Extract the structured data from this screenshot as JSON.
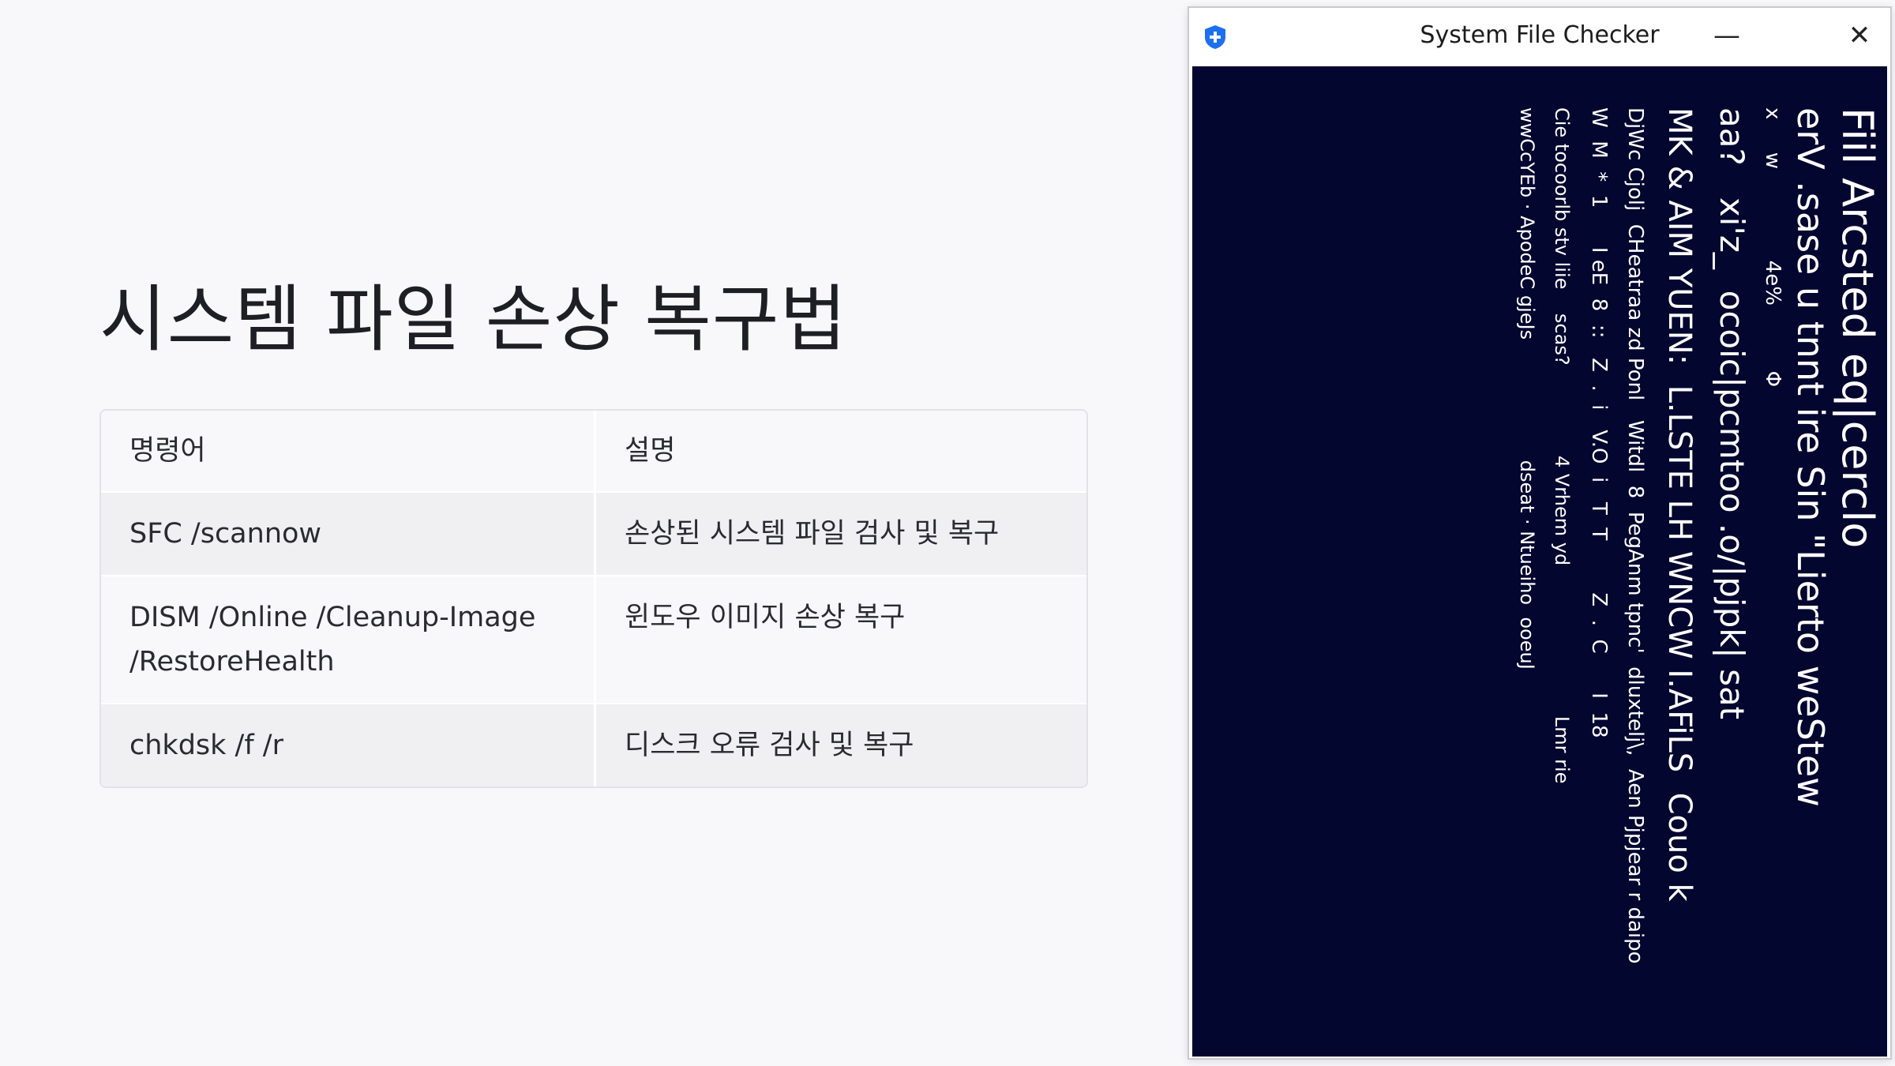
{
  "slide": {
    "title": "시스템 파일 손상 복구법",
    "table": {
      "headers": [
        "명령어",
        "설명"
      ],
      "rows": [
        {
          "command": "SFC /scannow",
          "description": "손상된 시스템 파일 검사 및 복구"
        },
        {
          "command_line1": "DISM /Online /Cleanup-Image",
          "command_line2": "/RestoreHealth",
          "description": "윈도우 이미지 손상 복구"
        },
        {
          "command": "chkdsk /f /r",
          "description": "디스크 오류 검사 및 복구"
        }
      ]
    }
  },
  "window": {
    "title": "System File Checker",
    "app_icon": "shield-plus-icon",
    "minimize_glyph": "—",
    "close_glyph": "✕",
    "colors": {
      "console_bg": "#03062f",
      "console_text": "#ffffff",
      "icon_blue": "#1e6ff0"
    },
    "console_lines": [
      "Fiil Arcsted eq|cerclo",
      "erV .sase u tnnt ire Sin \"Lierto weStew",
      "x     w              4e%          Φ",
      "aa?   xi'z_  ocoic|pcmtoo .o/|pjpk| sat",
      "MK & AIM YUEN:  L.LSTE LH WNCW I.AFiLS  Couo k",
      "DjWc Cjolj  CHeatraa zd Ponl   Witdl  8  PegAnm tpnc'  dluxtelj\\,  Aen Pjpjear r daipo",
      "W  M  *  1      I eE  8  ::   Z  .  i   V.O  i   T  T        Z  .  C      I  18",
      "Cie tocoorlb stv liie    scas?               4 Vrhem yd                         Lmr rie",
      "wwCcYEb · ApodeC gjeJs                    dseat · Ntueiho  ooeuJ"
    ]
  }
}
